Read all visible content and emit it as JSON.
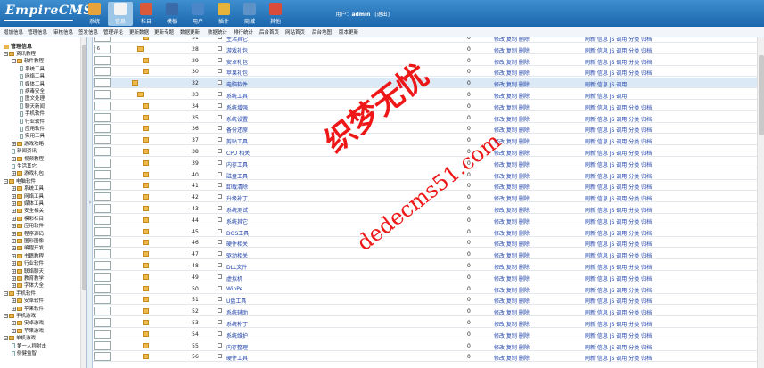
{
  "header": {
    "logo": "EmpireCMS",
    "nav": [
      {
        "label": "系统",
        "color": "#e7a33b"
      },
      {
        "label": "信息",
        "color": "#f3f3f3"
      },
      {
        "label": "栏目",
        "color": "#d85a3a"
      },
      {
        "label": "模板",
        "color": "#3b6aa8"
      },
      {
        "label": "用户",
        "color": "#4a86c8"
      },
      {
        "label": "插件",
        "color": "#e8b33a"
      },
      {
        "label": "商城",
        "color": "#5e93c8"
      },
      {
        "label": "其他",
        "color": "#d94c3c"
      }
    ],
    "user_prefix": "用户：",
    "user_name": "admin",
    "logout": "[退出]"
  },
  "subnav": [
    "增加信息",
    "管理信息",
    "审核信息",
    "签发信息",
    "管理评论",
    "更新数据",
    "更新专题",
    "数据更新",
    "数据统计",
    "排行统计",
    "后台首页",
    "网站首页",
    "后台地图",
    "版本更新"
  ],
  "sidebar": {
    "root": "管理信息",
    "items": [
      {
        "label": "资讯教程",
        "level": 0,
        "type": "open"
      },
      {
        "label": "软件教程",
        "level": 1,
        "type": "open"
      },
      {
        "label": "系统工具",
        "level": 2,
        "type": "page"
      },
      {
        "label": "网络工具",
        "level": 2,
        "type": "page"
      },
      {
        "label": "媒体工具",
        "level": 2,
        "type": "page"
      },
      {
        "label": "病毒安全",
        "level": 2,
        "type": "page"
      },
      {
        "label": "图文处理",
        "level": 2,
        "type": "page"
      },
      {
        "label": "聊天新闻",
        "level": 2,
        "type": "page"
      },
      {
        "label": "手机软件",
        "level": 2,
        "type": "page"
      },
      {
        "label": "行业软件",
        "level": 2,
        "type": "page"
      },
      {
        "label": "应用软件",
        "level": 2,
        "type": "page"
      },
      {
        "label": "实用工具",
        "level": 2,
        "type": "page"
      },
      {
        "label": "游戏攻略",
        "level": 1,
        "type": "closed"
      },
      {
        "label": "新闻资讯",
        "level": 1,
        "type": "page"
      },
      {
        "label": "视频教程",
        "level": 1,
        "type": "closed"
      },
      {
        "label": "生活其它",
        "level": 1,
        "type": "page"
      },
      {
        "label": "游戏礼包",
        "level": 1,
        "type": "closed"
      },
      {
        "label": "电脑软件",
        "level": 0,
        "type": "open"
      },
      {
        "label": "系统工具",
        "level": 1,
        "type": "closed"
      },
      {
        "label": "网络工具",
        "level": 1,
        "type": "closed"
      },
      {
        "label": "媒体工具",
        "level": 1,
        "type": "closed"
      },
      {
        "label": "安全相关",
        "level": 1,
        "type": "closed"
      },
      {
        "label": "模彩栏目",
        "level": 1,
        "type": "closed"
      },
      {
        "label": "应用软件",
        "level": 1,
        "type": "closed"
      },
      {
        "label": "程序源码",
        "level": 1,
        "type": "closed"
      },
      {
        "label": "图形图像",
        "level": 1,
        "type": "closed"
      },
      {
        "label": "编程开发",
        "level": 1,
        "type": "closed"
      },
      {
        "label": "书籍教程",
        "level": 1,
        "type": "closed"
      },
      {
        "label": "行业软件",
        "level": 1,
        "type": "closed"
      },
      {
        "label": "联络聊天",
        "level": 1,
        "type": "closed"
      },
      {
        "label": "教育教学",
        "level": 1,
        "type": "closed"
      },
      {
        "label": "字体大全",
        "level": 1,
        "type": "closed"
      },
      {
        "label": "手机软件",
        "level": 0,
        "type": "open"
      },
      {
        "label": "安卓软件",
        "level": 1,
        "type": "closed"
      },
      {
        "label": "苹果软件",
        "level": 1,
        "type": "closed"
      },
      {
        "label": "手机游戏",
        "level": 0,
        "type": "open"
      },
      {
        "label": "安卓游戏",
        "level": 1,
        "type": "closed"
      },
      {
        "label": "苹果游戏",
        "level": 1,
        "type": "closed"
      },
      {
        "label": "单机游戏",
        "level": 0,
        "type": "open"
      },
      {
        "label": "第一人称射击",
        "level": 1,
        "type": "page"
      },
      {
        "label": "侧健益智",
        "level": 1,
        "type": "page"
      }
    ]
  },
  "table": {
    "ops": "修改 复制 删除",
    "ops2": "刷新 信息 JS 调用",
    "ops2_full": "刷新 信息 JS 调用 分类 归档",
    "rows": [
      {
        "order": "",
        "id": "31",
        "name": "生活其它",
        "count": "0",
        "fold": 2,
        "full": true
      },
      {
        "order": "6",
        "id": "28",
        "name": "游戏礼包",
        "count": "0",
        "fold": 1,
        "full": true
      },
      {
        "order": "",
        "id": "29",
        "name": "安卓礼包",
        "count": "0",
        "fold": 2,
        "full": true
      },
      {
        "order": "",
        "id": "30",
        "name": "苹果礼包",
        "count": "0",
        "fold": 2,
        "full": true
      },
      {
        "order": "",
        "id": "32",
        "name": "电脑软件",
        "count": "0",
        "fold": 0,
        "full": false,
        "hl": true
      },
      {
        "order": "",
        "id": "33",
        "name": "系统工具",
        "count": "0",
        "fold": 1,
        "full": false
      },
      {
        "order": "",
        "id": "34",
        "name": "系统增强",
        "count": "0",
        "fold": 2,
        "full": true
      },
      {
        "order": "",
        "id": "35",
        "name": "系统设置",
        "count": "0",
        "fold": 2,
        "full": true
      },
      {
        "order": "",
        "id": "36",
        "name": "备份还原",
        "count": "0",
        "fold": 2,
        "full": true
      },
      {
        "order": "",
        "id": "37",
        "name": "剪贴工具",
        "count": "0",
        "fold": 2,
        "full": true
      },
      {
        "order": "",
        "id": "38",
        "name": "CPU 相关",
        "count": "0",
        "fold": 2,
        "full": true
      },
      {
        "order": "",
        "id": "39",
        "name": "内存工具",
        "count": "0",
        "fold": 2,
        "full": true
      },
      {
        "order": "",
        "id": "40",
        "name": "磁盘工具",
        "count": "0",
        "fold": 2,
        "full": true
      },
      {
        "order": "",
        "id": "41",
        "name": "卸载清除",
        "count": "0",
        "fold": 2,
        "full": true
      },
      {
        "order": "",
        "id": "42",
        "name": "升级补丁",
        "count": "0",
        "fold": 2,
        "full": true
      },
      {
        "order": "",
        "id": "43",
        "name": "系统测试",
        "count": "0",
        "fold": 2,
        "full": true
      },
      {
        "order": "",
        "id": "44",
        "name": "系统其它",
        "count": "0",
        "fold": 2,
        "full": true
      },
      {
        "order": "",
        "id": "45",
        "name": "DOS工具",
        "count": "0",
        "fold": 2,
        "full": true
      },
      {
        "order": "",
        "id": "46",
        "name": "硬件相关",
        "count": "0",
        "fold": 2,
        "full": true
      },
      {
        "order": "",
        "id": "47",
        "name": "驱动相关",
        "count": "0",
        "fold": 2,
        "full": true
      },
      {
        "order": "",
        "id": "48",
        "name": "DLL文件",
        "count": "0",
        "fold": 2,
        "full": true
      },
      {
        "order": "",
        "id": "49",
        "name": "虚拟机",
        "count": "0",
        "fold": 2,
        "full": true
      },
      {
        "order": "",
        "id": "50",
        "name": "WinPe",
        "count": "0",
        "fold": 2,
        "full": true
      },
      {
        "order": "",
        "id": "51",
        "name": "U盘工具",
        "count": "0",
        "fold": 2,
        "full": true
      },
      {
        "order": "",
        "id": "52",
        "name": "系统辅助",
        "count": "0",
        "fold": 2,
        "full": true
      },
      {
        "order": "",
        "id": "53",
        "name": "系统补丁",
        "count": "0",
        "fold": 2,
        "full": true
      },
      {
        "order": "",
        "id": "54",
        "name": "系统维护",
        "count": "0",
        "fold": 2,
        "full": true
      },
      {
        "order": "",
        "id": "55",
        "name": "内存整理",
        "count": "0",
        "fold": 2,
        "full": true
      },
      {
        "order": "",
        "id": "56",
        "name": "硬件工具",
        "count": "0",
        "fold": 2,
        "full": true
      }
    ]
  },
  "watermark": {
    "text1": "织梦无忧",
    "text2": "dedecms51.com",
    "color": "#e00000"
  }
}
